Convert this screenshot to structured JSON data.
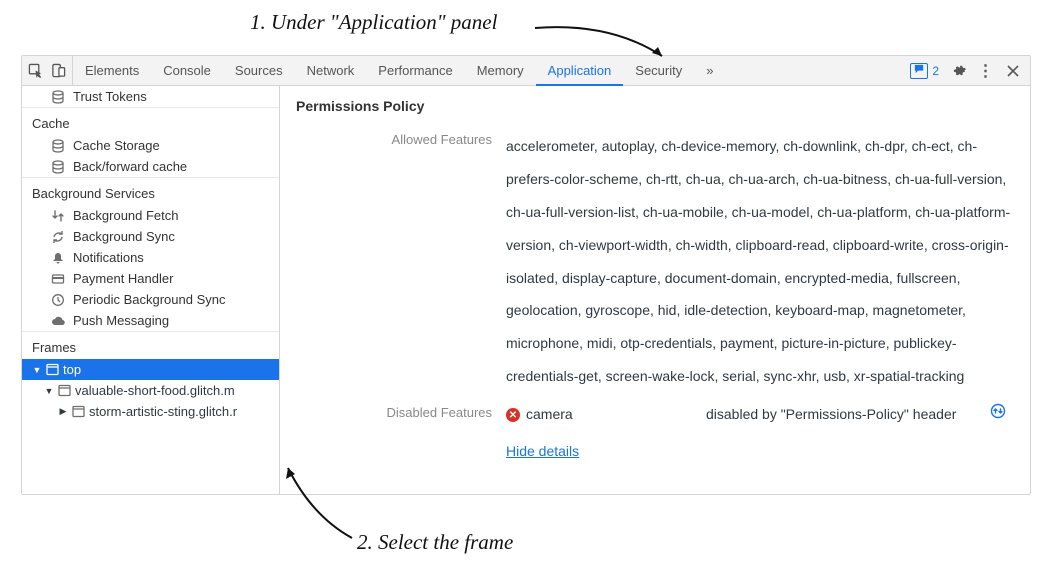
{
  "annotations": {
    "top": "1. Under \"Application\" panel",
    "bottom": "2. Select the frame"
  },
  "toolbar": {
    "tabs": [
      "Elements",
      "Console",
      "Sources",
      "Network",
      "Performance",
      "Memory",
      "Application",
      "Security"
    ],
    "active_tab": "Application",
    "more": "»",
    "issues_count": "2"
  },
  "sidebar": {
    "top_items": [
      {
        "icon": "database-icon",
        "label": "Trust Tokens"
      }
    ],
    "groups": [
      {
        "title": "Cache",
        "items": [
          {
            "icon": "database-icon",
            "label": "Cache Storage"
          },
          {
            "icon": "database-icon",
            "label": "Back/forward cache"
          }
        ]
      },
      {
        "title": "Background Services",
        "items": [
          {
            "icon": "fetch-icon",
            "label": "Background Fetch"
          },
          {
            "icon": "sync-icon",
            "label": "Background Sync"
          },
          {
            "icon": "bell-icon",
            "label": "Notifications"
          },
          {
            "icon": "card-icon",
            "label": "Payment Handler"
          },
          {
            "icon": "clock-icon",
            "label": "Periodic Background Sync"
          },
          {
            "icon": "cloud-icon",
            "label": "Push Messaging"
          }
        ]
      }
    ],
    "frames": {
      "title": "Frames",
      "tree": {
        "root": {
          "label": "top",
          "expanded": true,
          "selected": true
        },
        "children": [
          {
            "label": "valuable-short-food.glitch.m",
            "expanded": true,
            "children": [
              {
                "label": "storm-artistic-sting.glitch.r",
                "expanded": false
              }
            ]
          }
        ]
      }
    }
  },
  "main": {
    "section_title": "Permissions Policy",
    "allowed_label": "Allowed Features",
    "allowed_value": "accelerometer, autoplay, ch-device-memory, ch-downlink, ch-dpr, ch-ect, ch-prefers-color-scheme, ch-rtt, ch-ua, ch-ua-arch, ch-ua-bitness, ch-ua-full-version, ch-ua-full-version-list, ch-ua-mobile, ch-ua-model, ch-ua-platform, ch-ua-platform-version, ch-viewport-width, ch-width, clipboard-read, clipboard-write, cross-origin-isolated, display-capture, document-domain, encrypted-media, fullscreen, geolocation, gyroscope, hid, idle-detection, keyboard-map, magnetometer, microphone, midi, otp-credentials, payment, picture-in-picture, publickey-credentials-get, screen-wake-lock, serial, sync-xhr, usb, xr-spatial-tracking",
    "disabled_label": "Disabled Features",
    "disabled_feature": "camera",
    "disabled_reason": "disabled by \"Permissions-Policy\" header",
    "hide_details": "Hide details"
  }
}
